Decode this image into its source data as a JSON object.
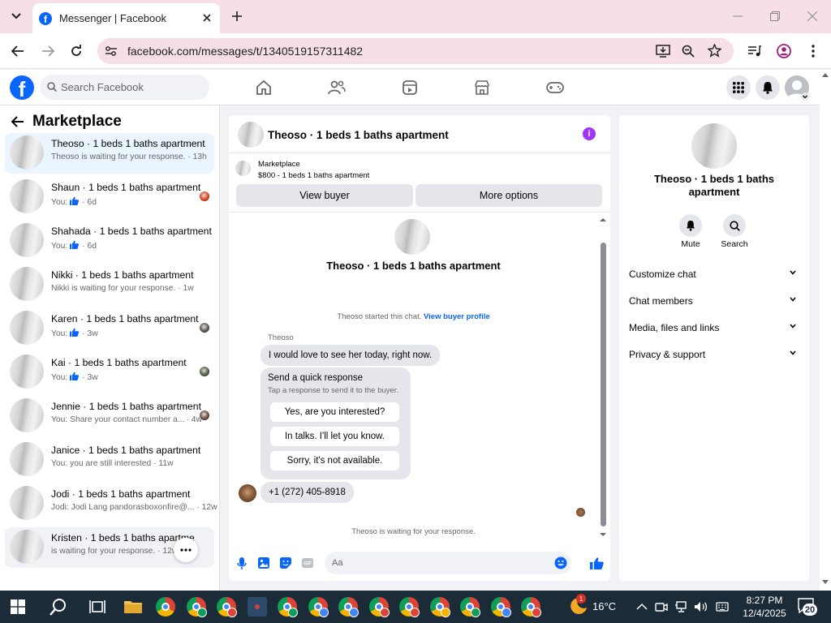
{
  "browser": {
    "tab_title": "Messenger | Facebook",
    "url": "facebook.com/messages/t/1340519157311482"
  },
  "fb": {
    "search_placeholder": "Search Facebook",
    "logo_letter": "f"
  },
  "sidebar": {
    "title": "Marketplace",
    "conversations": [
      {
        "name": "Theoso · 1 beds 1 baths apartment",
        "preview": "Theoso is waiting for your response. · 13h",
        "state": "active",
        "side_avatar": false,
        "thumb": false
      },
      {
        "name": "Shaun · 1 beds 1 baths apartment",
        "preview": "You:",
        "preview_time": "· 6d",
        "thumb": true,
        "side_avatar": true,
        "side_color": "#e0421b"
      },
      {
        "name": "Shahada · 1 beds 1 baths apartment",
        "preview": "You:",
        "preview_time": "· 6d",
        "thumb": true,
        "side_avatar": false
      },
      {
        "name": "Nikki · 1 beds 1 baths apartment",
        "preview": "Nikki is waiting for your response. · 1w",
        "side_avatar": false,
        "thumb": false
      },
      {
        "name": "Karen · 1 beds 1 baths apartment",
        "preview": "You:",
        "preview_time": "· 3w",
        "thumb": true,
        "side_avatar": true,
        "side_color": "#5b5552"
      },
      {
        "name": "Kai · 1 beds 1 baths apartment",
        "preview": "You:",
        "preview_time": "· 3w",
        "thumb": true,
        "side_avatar": true,
        "side_color": "#4e5a45"
      },
      {
        "name": "Jennie · 1 beds 1 baths apartment",
        "preview": "You: Share your contact number a...",
        "preview_time": "· 4w",
        "thumb": false,
        "side_avatar": true,
        "side_color": "#6b4a3a"
      },
      {
        "name": "Janice · 1 beds 1 baths apartment",
        "preview": "You: you are still interested · 11w",
        "side_avatar": false,
        "thumb": false
      },
      {
        "name": "Jodi · 1 beds 1 baths apartment",
        "preview": "Jodi: Jodi Lang pandorasboxonfire@... · 12w",
        "side_avatar": false,
        "thumb": false
      },
      {
        "name": "Kristen · 1 beds 1 baths apartme",
        "preview": "is waiting for your response. · 12w",
        "state": "hover",
        "side_avatar": false,
        "thumb": false
      }
    ]
  },
  "chat": {
    "title": "Theoso · 1 beds 1 baths apartment",
    "marketplace_label": "Marketplace",
    "listing": "$800 - 1 beds 1 baths apartment",
    "view_buyer": "View buyer",
    "more_options": "More options",
    "profile_name": "Theoso · 1 beds 1 baths apartment",
    "started_text": "Theoso started this chat.",
    "view_profile": "View buyer profile",
    "sender": "Theoso",
    "message1": "I would love to see her today, right now.",
    "quick_title": "Send a quick response",
    "quick_sub": "Tap a response to send it to the buyer.",
    "quick_options": [
      "Yes, are you interested?",
      "In talks. I'll let you know.",
      "Sorry, it's not available."
    ],
    "message2": "+1 (272) 405-8918",
    "waiting": "Theoso is waiting for your response.",
    "composer_placeholder": "Aa"
  },
  "info": {
    "name": "Theoso · 1 beds 1 baths apartment",
    "mute": "Mute",
    "search": "Search",
    "sections": [
      "Customize chat",
      "Chat members",
      "Media, files and links",
      "Privacy & support"
    ]
  },
  "taskbar": {
    "temperature": "16°C",
    "time": "8:27 PM",
    "date": "12/4/2025",
    "notif_count": "20",
    "weather_badge": "1"
  },
  "colors": {
    "fb_blue": "#0866ff",
    "accent_purple": "#a033ff",
    "active_row": "#ebf5ff",
    "taskbar": "#1c2b38"
  }
}
